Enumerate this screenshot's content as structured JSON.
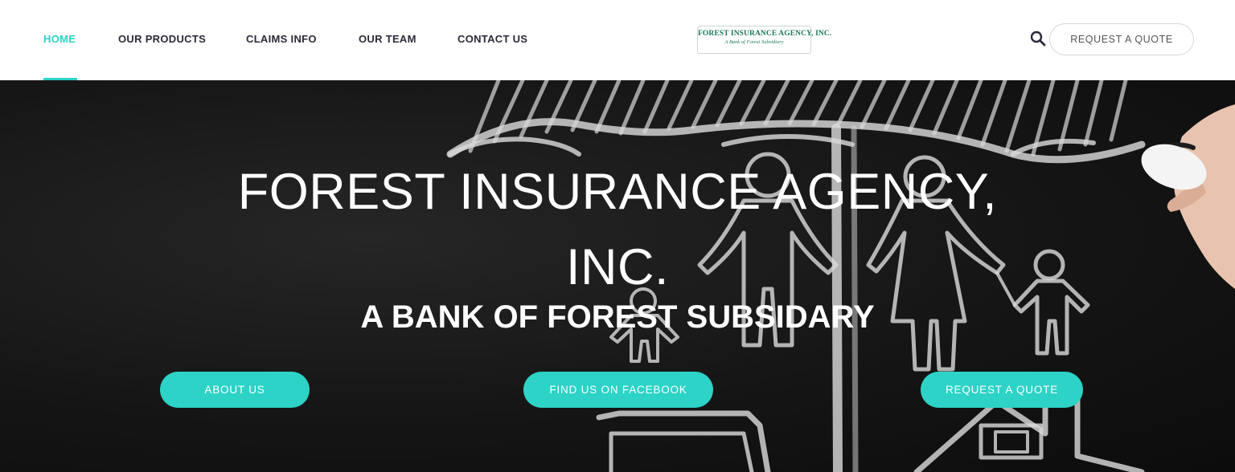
{
  "nav": {
    "items": [
      {
        "label": "HOME",
        "active": true
      },
      {
        "label": "OUR PRODUCTS"
      },
      {
        "label": "CLAIMS INFO"
      },
      {
        "label": "OUR TEAM"
      },
      {
        "label": "CONTACT US"
      }
    ]
  },
  "logo": {
    "main": "FOREST INSURANCE AGENCY, INC.",
    "sub": "A Bank of Forest Subsidiary"
  },
  "header": {
    "search_icon": "search-icon",
    "quote_button": "REQUEST A QUOTE"
  },
  "hero": {
    "title_line1": "FOREST INSURANCE AGENCY,",
    "title_line2": "INC.",
    "subtitle": "A BANK OF FOREST SUBSIDARY",
    "buttons": [
      "ABOUT US",
      "FIND US ON FACEBOOK",
      "REQUEST A QUOTE"
    ]
  },
  "colors": {
    "accent": "#2cd3c6",
    "nav_text": "#2b2b3a",
    "hero_bg": "#151515",
    "logo_green": "#1b7a55"
  }
}
